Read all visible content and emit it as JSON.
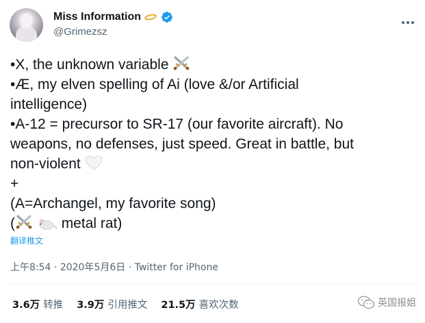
{
  "author": {
    "display_name": "Miss Information",
    "handle": "@Grimezsz"
  },
  "icons": {
    "avatar": "avatar-image",
    "halo": "halo-emoji",
    "verified": "verified-badge-icon",
    "more": "more-options-icon",
    "swords": "crossed-swords-emoji",
    "heart": "white-heart-emoji",
    "rat": "rat-emoji"
  },
  "tweet": {
    "lines": [
      "•X, the unknown variable",
      "•Æ, my elven spelling of Ai (love &/or Artificial",
      "intelligence)",
      "•A-12 = precursor to SR-17 (our favorite aircraft).  No",
      "weapons, no defenses, just speed.  Great in battle, but",
      "non-violent",
      "+",
      "(A=Archangel, my favorite song)",
      "(",
      "metal rat)"
    ]
  },
  "translate_label": "翻译推文",
  "meta": {
    "time": "上午8:54",
    "date": "2020年5月6日",
    "source": "Twitter for iPhone",
    "separator": "·"
  },
  "stats": {
    "retweets_count": "3.6万",
    "retweets_label": "转推",
    "quotes_count": "3.9万",
    "quotes_label": "引用推文",
    "likes_count": "21.5万",
    "likes_label": "喜欢次数"
  },
  "watermark": {
    "text": "英国报姐"
  },
  "colors": {
    "link": "#1d9bf0",
    "verified": "#1d9bf0",
    "secondary_text": "#536471",
    "primary_text": "#0f1419"
  }
}
